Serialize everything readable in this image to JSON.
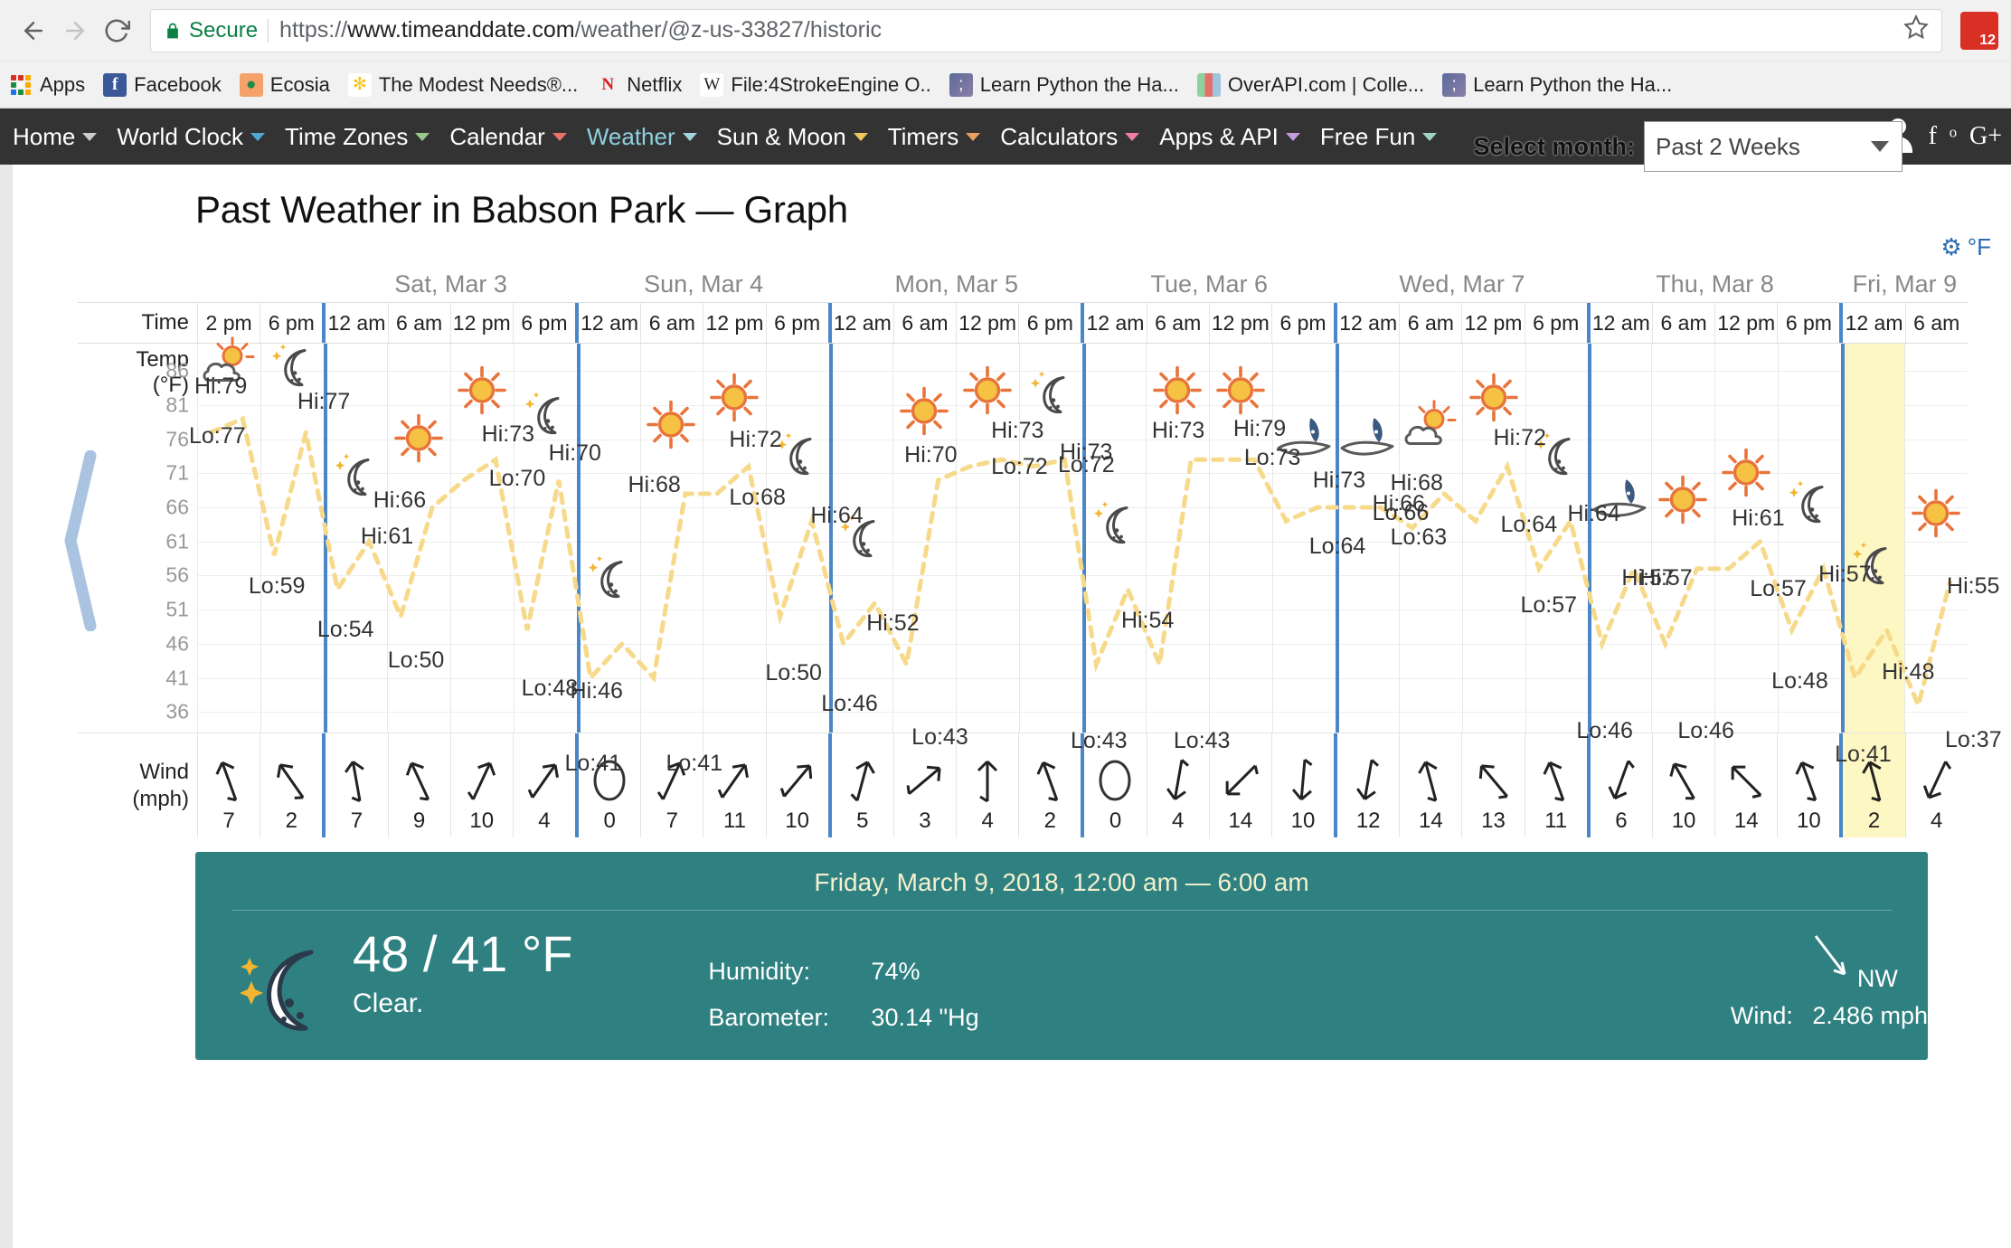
{
  "browser": {
    "security_label": "Secure",
    "url_scheme": "https://",
    "url_host": "www.timeanddate.com",
    "url_path": "/weather/@z-us-33827/historic",
    "extension_badge_count": "12",
    "bookmarks": [
      {
        "label": "Apps",
        "icon": "apps-grid-icon"
      },
      {
        "label": "Facebook",
        "icon": "facebook-icon"
      },
      {
        "label": "Ecosia",
        "icon": "ecosia-icon"
      },
      {
        "label": "The Modest Needs®...",
        "icon": "modest-needs-icon"
      },
      {
        "label": "Netflix",
        "icon": "netflix-icon"
      },
      {
        "label": "File:4StrokeEngine O..",
        "icon": "wikipedia-icon"
      },
      {
        "label": "Learn Python the Ha...",
        "icon": "python-icon"
      },
      {
        "label": "OverAPI.com | Colle...",
        "icon": "overapi-icon"
      },
      {
        "label": "Learn Python the Ha...",
        "icon": "python-icon"
      }
    ]
  },
  "site_nav": {
    "items": [
      {
        "label": "Home",
        "caret": "#cccccc",
        "active": false
      },
      {
        "label": "World Clock",
        "caret": "#4fa8d8",
        "active": false
      },
      {
        "label": "Time Zones",
        "caret": "#9dc88d",
        "active": false
      },
      {
        "label": "Calendar",
        "caret": "#e8736a",
        "active": false
      },
      {
        "label": "Weather",
        "caret": "#9fd4e0",
        "active": true
      },
      {
        "label": "Sun & Moon",
        "caret": "#f0c75e",
        "active": false
      },
      {
        "label": "Timers",
        "caret": "#e8a05e",
        "active": false
      },
      {
        "label": "Calculators",
        "caret": "#f07fa8",
        "active": false
      },
      {
        "label": "Apps & API",
        "caret": "#c49ae0",
        "active": false
      },
      {
        "label": "Free Fun",
        "caret": "#9fd4c4",
        "active": false
      }
    ],
    "social": [
      "f",
      "t",
      "G+"
    ],
    "active_color": "#8fd0de"
  },
  "month_picker": {
    "label": "Select month:",
    "value": "Past 2 Weeks"
  },
  "page": {
    "title": "Past Weather in Babson Park — Graph",
    "unit_toggle": "°F",
    "gear_icon": "gear-icon"
  },
  "chart_data": {
    "type": "line",
    "title": "Past Weather in Babson Park — Graph",
    "ylabel": "Temp (°F)",
    "xlabel": "Time",
    "ylim": [
      33,
      90
    ],
    "yticks": [
      86,
      81,
      76,
      71,
      66,
      61,
      56,
      51,
      46,
      41,
      36
    ],
    "grid": true,
    "today_highlight": "Fri, Mar 9 12 am",
    "days": [
      {
        "label": "",
        "span": 2
      },
      {
        "label": "Sat, Mar 3",
        "span": 4
      },
      {
        "label": "Sun, Mar 4",
        "span": 4
      },
      {
        "label": "Mon, Mar 5",
        "span": 4
      },
      {
        "label": "Tue, Mar 6",
        "span": 4
      },
      {
        "label": "Wed, Mar 7",
        "span": 4
      },
      {
        "label": "Thu, Mar 8",
        "span": 4
      },
      {
        "label": "Fri, Mar 9",
        "span": 2
      }
    ],
    "categories": [
      "2 pm",
      "6 pm",
      "12 am",
      "6 am",
      "12 pm",
      "6 pm",
      "12 am",
      "6 am",
      "12 pm",
      "6 pm",
      "12 am",
      "6 am",
      "12 pm",
      "6 pm",
      "12 am",
      "6 am",
      "12 pm",
      "6 pm",
      "12 am",
      "6 am",
      "12 pm",
      "6 pm",
      "12 am",
      "6 am",
      "12 pm",
      "6 pm",
      "12 am",
      "6 am"
    ],
    "day_start_indices": [
      2,
      6,
      10,
      14,
      18,
      22,
      26
    ],
    "series": [
      {
        "name": "High (°F)",
        "values": [
          79,
          77,
          61,
          66,
          73,
          70,
          46,
          68,
          72,
          64,
          52,
          70,
          73,
          73,
          54,
          73,
          73,
          66,
          66,
          68,
          72,
          64,
          57,
          57,
          61,
          57,
          48,
          55
        ]
      },
      {
        "name": "Low (°F)",
        "values": [
          77,
          59,
          54,
          50,
          70,
          48,
          41,
          41,
          68,
          50,
          46,
          43,
          72,
          72,
          43,
          43,
          73,
          64,
          66,
          63,
          64,
          57,
          46,
          46,
          57,
          48,
          41,
          37
        ]
      }
    ],
    "hi_labels": [
      "Hi:79",
      "Hi:77",
      "Hi:61",
      "Hi:66",
      "Hi:73",
      "Hi:70",
      "Hi:46",
      "Hi:68",
      "Hi:72",
      "Hi:64",
      "Hi:52",
      "Hi:70",
      "Hi:73",
      "Hi:73",
      "Hi:54",
      "Hi:73",
      "Hi:79",
      "Hi:73",
      "Hi:66",
      "Hi:68",
      "Hi:72",
      "Hi:64",
      "Hi:57",
      "Hi:57",
      "Hi:61",
      "Hi:57",
      "Hi:48",
      "Hi:55"
    ],
    "lo_labels": [
      "Lo:77",
      "Lo:59",
      "Lo:54",
      "Lo:50",
      "Lo:70",
      "Lo:48",
      "Lo:41",
      "Lo:41",
      "Lo:68",
      "Lo:50",
      "Lo:46",
      "Lo:43",
      "Lo:72",
      "Lo:72",
      "Lo:43",
      "Lo:43",
      "Lo:73",
      "Lo:64",
      "Lo:66",
      "Lo:63",
      "Lo:64",
      "Lo:57",
      "Lo:46",
      "Lo:46",
      "Lo:57",
      "Lo:48",
      "Lo:41",
      "Lo:37"
    ],
    "weather_icons": [
      "partly-sunny-icon",
      "moon-icon",
      "moon-icon",
      "sun-icon",
      "sun-icon",
      "moon-icon",
      "moon-icon",
      "sun-icon",
      "sun-icon",
      "moon-icon",
      "moon-icon",
      "sun-icon",
      "sun-icon",
      "moon-icon",
      "moon-icon",
      "sun-icon",
      "sun-icon",
      "wind-icon",
      "wind-icon",
      "partly-sunny-icon",
      "sun-icon",
      "moon-icon",
      "wind-icon",
      "sun-icon",
      "sun-icon",
      "moon-icon",
      "moon-icon",
      "sun-icon"
    ],
    "wind": {
      "row_label_line1": "Wind",
      "row_label_line2": "(mph)",
      "speeds": [
        7,
        2,
        7,
        9,
        10,
        4,
        0,
        7,
        11,
        10,
        5,
        3,
        4,
        2,
        0,
        4,
        14,
        10,
        12,
        14,
        13,
        11,
        6,
        10,
        14,
        10,
        2,
        4
      ],
      "directions_deg": [
        160,
        145,
        170,
        155,
        205,
        215,
        0,
        205,
        215,
        220,
        195,
        230,
        180,
        160,
        0,
        10,
        45,
        5,
        10,
        165,
        140,
        160,
        20,
        150,
        135,
        160,
        165,
        25
      ]
    }
  },
  "detail_panel": {
    "date": "Friday, March 9, 2018, 12:00 am — 6:00 am",
    "temperature": "48 / 41 °F",
    "condition": "Clear.",
    "icon": "moon-stars-icon",
    "humidity_label": "Humidity:",
    "humidity_value": "74%",
    "barometer_label": "Barometer:",
    "barometer_value": "30.14 \"Hg",
    "wind_direction": "NW",
    "wind_label": "Wind:",
    "wind_value": "2.486 mph",
    "wind_arrow_icon": "wind-arrow-icon",
    "panel_color": "#2f8080"
  }
}
